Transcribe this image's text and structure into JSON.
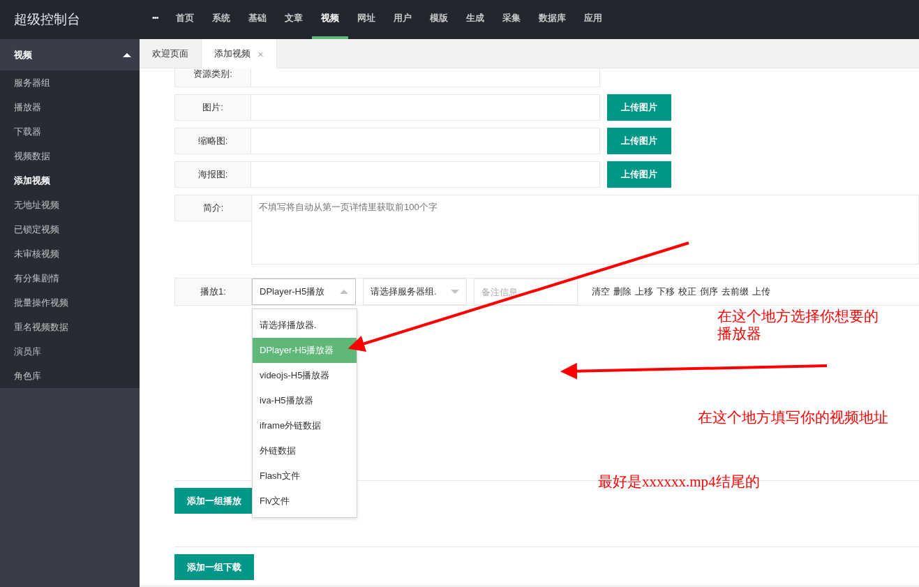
{
  "app_title": "超级控制台",
  "top_nav": {
    "more": "•••",
    "items": [
      {
        "label": "首页",
        "selected": false
      },
      {
        "label": "系统",
        "selected": false
      },
      {
        "label": "基础",
        "selected": false
      },
      {
        "label": "文章",
        "selected": false
      },
      {
        "label": "视频",
        "selected": true
      },
      {
        "label": "网址",
        "selected": false
      },
      {
        "label": "用户",
        "selected": false
      },
      {
        "label": "模版",
        "selected": false
      },
      {
        "label": "生成",
        "selected": false
      },
      {
        "label": "采集",
        "selected": false
      },
      {
        "label": "数据库",
        "selected": false
      },
      {
        "label": "应用",
        "selected": false
      }
    ]
  },
  "sidebar": {
    "section": {
      "label": "视频",
      "expanded": true
    },
    "items": [
      {
        "label": "服务器组",
        "selected": false
      },
      {
        "label": "播放器",
        "selected": false
      },
      {
        "label": "下载器",
        "selected": false
      },
      {
        "label": "视频数据",
        "selected": false
      },
      {
        "label": "添加视频",
        "selected": true
      },
      {
        "label": "无地址视频",
        "selected": false
      },
      {
        "label": "已锁定视频",
        "selected": false
      },
      {
        "label": "未审核视频",
        "selected": false
      },
      {
        "label": "有分集剧情",
        "selected": false
      },
      {
        "label": "批量操作视频",
        "selected": false
      },
      {
        "label": "重名视频数据",
        "selected": false
      },
      {
        "label": "演员库",
        "selected": false
      },
      {
        "label": "角色库",
        "selected": false
      }
    ]
  },
  "tabs": [
    {
      "label": "欢迎页面",
      "selected": false
    },
    {
      "label": "添加视频",
      "selected": true,
      "close": "×"
    }
  ],
  "form": {
    "rows": [
      {
        "kind": "input",
        "label": "资源类别:"
      },
      {
        "kind": "upload",
        "label": "图片:",
        "button": "上传图片"
      },
      {
        "kind": "upload",
        "label": "缩略图:",
        "button": "上传图片"
      },
      {
        "kind": "upload",
        "label": "海报图:",
        "button": "上传图片"
      },
      {
        "kind": "textarea",
        "label": "简介:",
        "placeholder": "不填写将自动从第一页详情里获取前100个字"
      }
    ],
    "play_row": {
      "label": "播放1:",
      "player_select": {
        "value": "DPlayer-H5播放",
        "expanded": true,
        "options": [
          {
            "label": "请选择播放器.",
            "selected": false
          },
          {
            "label": "DPlayer-H5播放器",
            "selected": true
          },
          {
            "label": "videojs-H5播放器",
            "selected": false
          },
          {
            "label": "iva-H5播放器",
            "selected": false
          },
          {
            "label": "iframe外链数据",
            "selected": false
          },
          {
            "label": "外链数据",
            "selected": false
          },
          {
            "label": "Flash文件",
            "selected": false
          },
          {
            "label": "Flv文件",
            "selected": false
          }
        ]
      },
      "server_select": {
        "value": "请选择服务器组.",
        "expanded": false
      },
      "note": {
        "placeholder": "备注信息"
      },
      "actions": [
        "清空",
        "删除",
        "上移",
        "下移",
        "校正",
        "倒序",
        "去前缀",
        "上传"
      ]
    },
    "add_play_button": "添加一组播放",
    "add_download_button": "添加一组下载"
  },
  "annotations": [
    {
      "text": "在这个地方选择你想要的播放器"
    },
    {
      "text": "在这个地方填写你的视频地址"
    },
    {
      "text": "最好是xxxxxx.mp4结尾的"
    }
  ]
}
